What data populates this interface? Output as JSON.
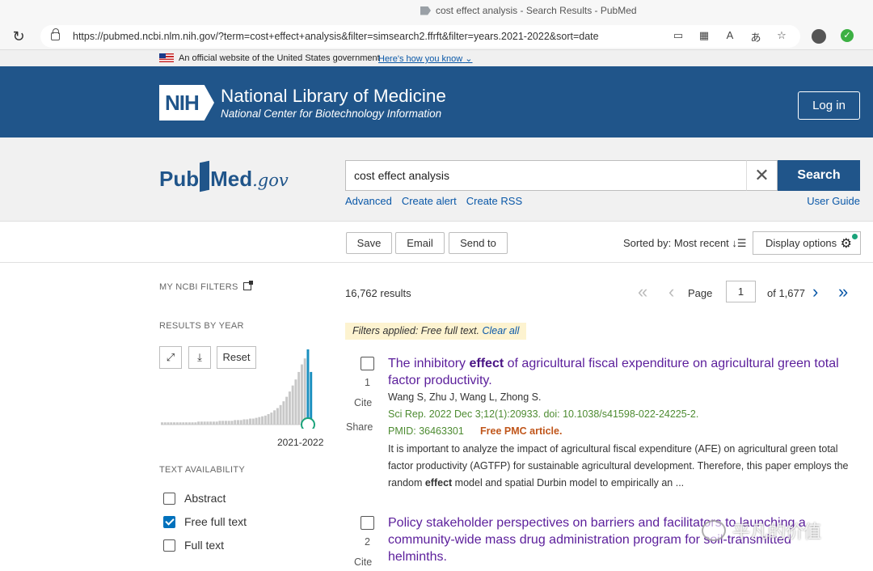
{
  "browser": {
    "tab_title": "cost effect analysis - Search Results - PubMed",
    "url": "https://pubmed.ncbi.nlm.nih.gov/?term=cost+effect+analysis&filter=simsearch2.ffrft&filter=years.2021-2022&sort=date"
  },
  "gov_banner": {
    "text": "An official website of the United States government",
    "link": "Here's how you know"
  },
  "nlm_header": {
    "logo": "NIH",
    "title": "National Library of Medicine",
    "subtitle": "National Center for Biotechnology Information",
    "login_label": "Log in"
  },
  "search": {
    "logo_pub": "Pub",
    "logo_med": "Med",
    "logo_gov": ".gov",
    "query": "cost effect analysis",
    "button_label": "Search",
    "links": [
      "Advanced",
      "Create alert",
      "Create RSS"
    ],
    "user_guide": "User Guide"
  },
  "toolbar": {
    "save": "Save",
    "email": "Email",
    "send_to": "Send to",
    "sorted_by": "Sorted by: Most recent",
    "display_options": "Display options"
  },
  "sidebar": {
    "my_ncbi_filters": "MY NCBI FILTERS",
    "results_by_year": "RESULTS BY YEAR",
    "reset_label": "Reset",
    "year_range_label": "2021-2022",
    "histogram_relative_values": [
      0.03,
      0.03,
      0.03,
      0.03,
      0.03,
      0.03,
      0.03,
      0.03,
      0.03,
      0.03,
      0.03,
      0.03,
      0.04,
      0.04,
      0.04,
      0.04,
      0.04,
      0.04,
      0.04,
      0.05,
      0.05,
      0.05,
      0.05,
      0.05,
      0.06,
      0.06,
      0.06,
      0.07,
      0.07,
      0.08,
      0.08,
      0.09,
      0.1,
      0.11,
      0.12,
      0.14,
      0.16,
      0.19,
      0.22,
      0.26,
      0.31,
      0.37,
      0.44,
      0.52,
      0.6,
      0.7,
      0.8,
      0.88,
      1.0,
      0.7
    ],
    "text_availability": "TEXT AVAILABILITY",
    "text_filters": [
      {
        "label": "Abstract",
        "checked": false
      },
      {
        "label": "Free full text",
        "checked": true
      },
      {
        "label": "Full text",
        "checked": false
      }
    ]
  },
  "results": {
    "count": "16,762 results",
    "page_label": "Page",
    "page_value": "1",
    "page_total": "of 1,677",
    "filters_applied": "Filters applied: Free full text.",
    "clear_all": "Clear all",
    "items": [
      {
        "num": "1",
        "cite": "Cite",
        "share": "Share",
        "title_pre": "The inhibitory ",
        "title_bold": "effect",
        "title_post": " of agricultural fiscal expenditure on agricultural green total factor productivity.",
        "authors": "Wang S, Zhu J, Wang L, Zhong S.",
        "citation": "Sci Rep. 2022 Dec 3;12(1):20933. doi: 10.1038/s41598-022-24225-2.",
        "pmid": "PMID: 36463301",
        "pmc": "Free PMC article.",
        "snippet_pre": "It is important to analyze the impact of agricultural fiscal expenditure (AFE) on agricultural green total factor productivity (AGTFP) for sustainable agricultural development. Therefore, this paper employs the random ",
        "snippet_bold": "effect",
        "snippet_post": " model and spatial Durbin model to empirically an ..."
      },
      {
        "num": "2",
        "cite": "Cite",
        "title": "Policy stakeholder perspectives on barriers and facilitators to launching a community-wide mass drug administration program for soil-transmitted helminths."
      }
    ]
  },
  "watermark": "平凡的价值"
}
